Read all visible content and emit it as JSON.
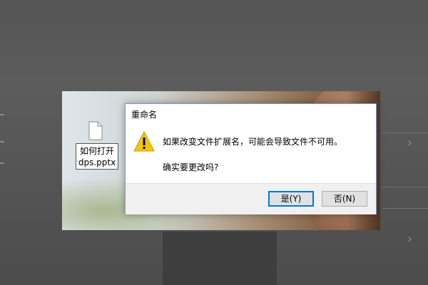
{
  "dialog": {
    "title": "重命名",
    "message_line1": "如果改变文件扩展名，可能会导致文件不可用。",
    "message_line2": "确实要更改吗?",
    "yes_button": "是(Y)",
    "no_button": "否(N)"
  },
  "file": {
    "name_line1": "如何打开",
    "name_line2": "dps.pptx"
  },
  "icons": {
    "dialog": "warning-icon",
    "file": "file-icon"
  },
  "colors": {
    "dialog_border": "#7a9ec5",
    "default_button_border": "#0078d7",
    "footer_background": "#f0f0f0",
    "warning_fill": "#f7c600"
  }
}
